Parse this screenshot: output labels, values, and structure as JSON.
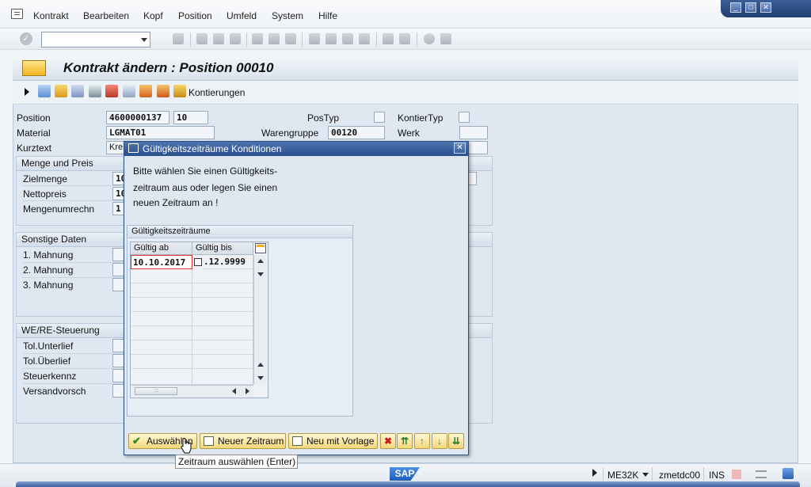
{
  "menu": {
    "items": [
      "Kontrakt",
      "Bearbeiten",
      "Kopf",
      "Position",
      "Umfeld",
      "System",
      "Hilfe"
    ]
  },
  "window_controls": [
    "_",
    "□",
    "✕"
  ],
  "page_title": "Kontrakt ändern : Position 00010",
  "app_toolbar": {
    "kontierungen_label": "Kontierungen"
  },
  "header_fields": {
    "position_label": "Position",
    "position_contract": "4600000137",
    "position_item": "10",
    "material_label": "Material",
    "material_value": "LGMAT01",
    "kurztext_label": "Kurztext",
    "kurztext_value": "Kre",
    "postyp_label": "PosTyp",
    "kontiertyp_label": "KontierTyp",
    "warengruppe_label": "Warengruppe",
    "warengruppe_value": "00120",
    "werk_label": "Werk"
  },
  "groups": {
    "menge": {
      "title": "Menge und Preis",
      "rows": [
        {
          "label": "Zielmenge",
          "value": "10"
        },
        {
          "label": "Nettopreis",
          "value": "10"
        },
        {
          "label": "Mengenumrechn",
          "value": "1"
        }
      ]
    },
    "sonstige": {
      "title": "Sonstige Daten",
      "rows": [
        {
          "label": "1. Mahnung"
        },
        {
          "label": "2. Mahnung"
        },
        {
          "label": "3. Mahnung"
        }
      ]
    },
    "were": {
      "title": "WE/RE-Steuerung",
      "rows": [
        {
          "label": "Tol.Unterlief"
        },
        {
          "label": "Tol.Überlief"
        },
        {
          "label": "Steuerkennz"
        },
        {
          "label": "Versandvorsch"
        }
      ]
    }
  },
  "dialog": {
    "title": "Gültigkeitszeiträume Konditionen",
    "message": [
      "Bitte wählen Sie einen Gültigkeits-",
      "zeitraum aus oder legen Sie einen",
      "neuen Zeitraum an !"
    ],
    "table": {
      "title": "Gültigkeitszeiträume",
      "columns": [
        "Gültig ab",
        "Gültig bis"
      ],
      "rows": [
        {
          "from": "10.10.2017",
          "to": ".12.9999"
        }
      ]
    },
    "buttons": {
      "select": "Auswählen",
      "new_period": "Neuer Zeitraum",
      "new_with_template": "Neu mit Vorlage"
    },
    "tooltip": "Zeitraum auswählen   (Enter)"
  },
  "status_bar": {
    "transaction": "ME32K",
    "server": "zmetdc00",
    "mode": "INS"
  },
  "logo_text": "SAP",
  "colors": {
    "dialog_title": "#294f8d",
    "button_bg": "#f5d67a",
    "screen_bg": "#dfe8f1",
    "focus_border": "#e03030"
  }
}
